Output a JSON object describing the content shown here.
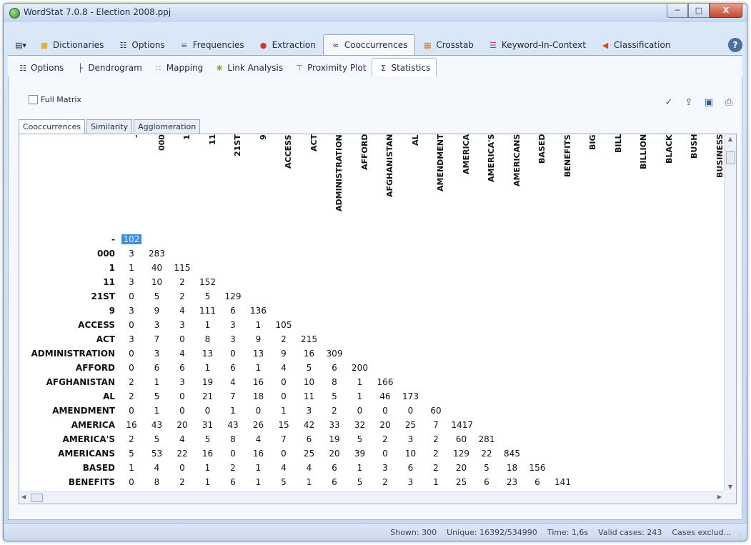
{
  "window": {
    "title": "WordStat 7.0.8 - Election 2008.ppj"
  },
  "main_tabs": [
    {
      "label": "",
      "icon": "document-menu-icon"
    },
    {
      "label": "Dictionaries",
      "icon": "folder-icon"
    },
    {
      "label": "Options",
      "icon": "options-icon"
    },
    {
      "label": "Frequencies",
      "icon": "frequencies-icon"
    },
    {
      "label": "Extraction",
      "icon": "extraction-icon"
    },
    {
      "label": "Cooccurrences",
      "icon": "link-icon"
    },
    {
      "label": "Crosstab",
      "icon": "table-icon"
    },
    {
      "label": "Keyword-In-Context",
      "icon": "kwic-icon"
    },
    {
      "label": "Classification",
      "icon": "classification-icon"
    }
  ],
  "sub_tabs": [
    {
      "label": "Options",
      "icon": "options-icon"
    },
    {
      "label": "Dendrogram",
      "icon": "dendrogram-icon"
    },
    {
      "label": "Mapping",
      "icon": "mapping-icon"
    },
    {
      "label": "Link Analysis",
      "icon": "link-analysis-icon"
    },
    {
      "label": "Proximity Plot",
      "icon": "proximity-plot-icon"
    },
    {
      "label": "Statistics",
      "icon": "sigma-icon"
    }
  ],
  "full_matrix_label": "Full Matrix",
  "stat_tabs": [
    "Cooccurrences",
    "Similarity",
    "Agglomeration"
  ],
  "matrix": {
    "columns": [
      "-",
      "000",
      "1",
      "11",
      "21ST",
      "9",
      "ACCESS",
      "ACT",
      "ADMINISTRATION",
      "AFFORD",
      "AFGHANISTAN",
      "AL",
      "AMENDMENT",
      "AMERICA",
      "AMERICA'S",
      "AMERICANS",
      "BASED",
      "BENEFITS",
      "BIG",
      "BILL",
      "BILLION",
      "BLACK",
      "BUSH",
      "BUSINESS"
    ],
    "rows": [
      {
        "label": "-",
        "values": [
          "102"
        ]
      },
      {
        "label": "000",
        "values": [
          "3",
          "283"
        ]
      },
      {
        "label": "1",
        "values": [
          "1",
          "40",
          "115"
        ]
      },
      {
        "label": "11",
        "values": [
          "3",
          "10",
          "2",
          "152"
        ]
      },
      {
        "label": "21ST",
        "values": [
          "0",
          "5",
          "2",
          "5",
          "129"
        ]
      },
      {
        "label": "9",
        "values": [
          "3",
          "9",
          "4",
          "111",
          "6",
          "136"
        ]
      },
      {
        "label": "ACCESS",
        "values": [
          "0",
          "3",
          "3",
          "1",
          "3",
          "1",
          "105"
        ]
      },
      {
        "label": "ACT",
        "values": [
          "3",
          "7",
          "0",
          "8",
          "3",
          "9",
          "2",
          "215"
        ]
      },
      {
        "label": "ADMINISTRATION",
        "values": [
          "0",
          "3",
          "4",
          "13",
          "0",
          "13",
          "9",
          "16",
          "309"
        ]
      },
      {
        "label": "AFFORD",
        "values": [
          "0",
          "6",
          "6",
          "1",
          "6",
          "1",
          "4",
          "5",
          "6",
          "200"
        ]
      },
      {
        "label": "AFGHANISTAN",
        "values": [
          "2",
          "1",
          "3",
          "19",
          "4",
          "16",
          "0",
          "10",
          "8",
          "1",
          "166"
        ]
      },
      {
        "label": "AL",
        "values": [
          "2",
          "5",
          "0",
          "21",
          "7",
          "18",
          "0",
          "11",
          "5",
          "1",
          "46",
          "173"
        ]
      },
      {
        "label": "AMENDMENT",
        "values": [
          "0",
          "1",
          "0",
          "0",
          "1",
          "0",
          "1",
          "3",
          "2",
          "0",
          "0",
          "0",
          "60"
        ]
      },
      {
        "label": "AMERICA",
        "values": [
          "16",
          "43",
          "20",
          "31",
          "43",
          "26",
          "15",
          "42",
          "33",
          "32",
          "20",
          "25",
          "7",
          "1417"
        ]
      },
      {
        "label": "AMERICA'S",
        "values": [
          "2",
          "5",
          "4",
          "5",
          "8",
          "4",
          "7",
          "6",
          "19",
          "5",
          "2",
          "3",
          "2",
          "60",
          "281"
        ]
      },
      {
        "label": "AMERICANS",
        "values": [
          "5",
          "53",
          "22",
          "16",
          "0",
          "16",
          "0",
          "25",
          "20",
          "39",
          "0",
          "10",
          "2",
          "129",
          "22",
          "845"
        ]
      },
      {
        "label": "BASED",
        "values": [
          "1",
          "4",
          "0",
          "1",
          "2",
          "1",
          "4",
          "4",
          "6",
          "1",
          "3",
          "6",
          "2",
          "20",
          "5",
          "18",
          "156"
        ]
      },
      {
        "label": "BENEFITS",
        "values": [
          "0",
          "8",
          "2",
          "1",
          "6",
          "1",
          "5",
          "1",
          "6",
          "5",
          "2",
          "3",
          "1",
          "25",
          "6",
          "23",
          "6",
          "141"
        ]
      }
    ]
  },
  "status": {
    "shown": "Shown: 300",
    "unique": "Unique: 16392/534990",
    "time": "Time: 1,6s",
    "valid_cases": "Valid cases: 243",
    "cases_excluded": "Cases exclud..."
  }
}
